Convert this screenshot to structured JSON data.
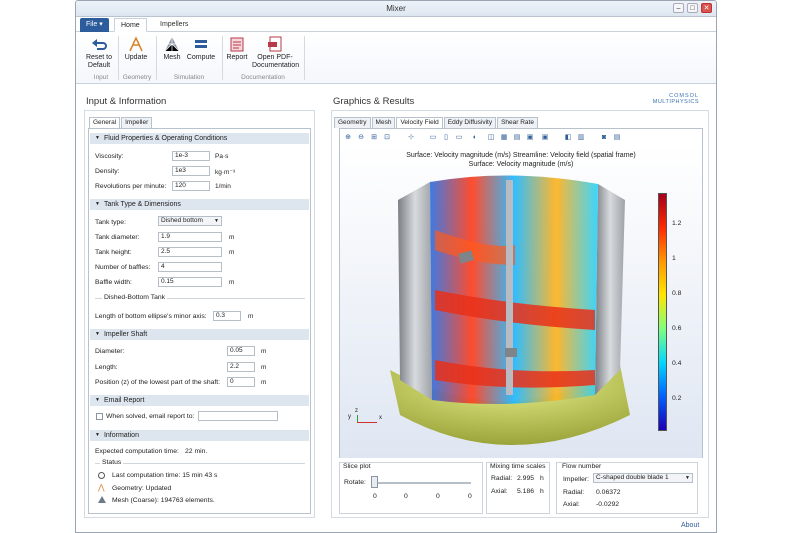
{
  "window": {
    "title": "Mixer"
  },
  "tabs": {
    "file": "File ▾",
    "home": "Home",
    "impellers": "Impellers"
  },
  "ribbon": {
    "reset": "Reset to\nDefault",
    "update": "Update",
    "mesh": "Mesh",
    "compute": "Compute",
    "report": "Report",
    "open_pdf": "Open PDF-\nDocumentation",
    "groups": {
      "input": "Input",
      "geometry": "Geometry",
      "simulation": "Simulation",
      "documentation": "Documentation"
    }
  },
  "left": {
    "title": "Input & Information",
    "tabs": [
      "General",
      "Impeller"
    ],
    "fluid": {
      "header": "Fluid Properties & Operating Conditions",
      "viscosity": {
        "label": "Viscosity:",
        "value": "1e-3",
        "unit": "Pa·s"
      },
      "density": {
        "label": "Density:",
        "value": "1e3",
        "unit": "kg·m⁻³"
      },
      "rpm": {
        "label": "Revolutions per minute:",
        "value": "120",
        "unit": "1/min"
      }
    },
    "tank": {
      "header": "Tank Type & Dimensions",
      "type": {
        "label": "Tank type:",
        "value": "Dished bottom"
      },
      "diameter": {
        "label": "Tank diameter:",
        "value": "1.9",
        "unit": "m"
      },
      "height": {
        "label": "Tank height:",
        "value": "2.5",
        "unit": "m"
      },
      "baffles": {
        "label": "Number of baffles:",
        "value": "4"
      },
      "baffle_width": {
        "label": "Baffle width:",
        "value": "0.15",
        "unit": "m"
      },
      "dished_header": "Dished-Bottom Tank",
      "ellipse": {
        "label": "Length of bottom ellipse's minor axis:",
        "value": "0.3",
        "unit": "m"
      }
    },
    "shaft": {
      "header": "Impeller Shaft",
      "diameter": {
        "label": "Diameter:",
        "value": "0.05",
        "unit": "m"
      },
      "length": {
        "label": "Length:",
        "value": "2.2",
        "unit": "m"
      },
      "position": {
        "label": "Position (z) of the lowest part of the shaft:",
        "value": "0",
        "unit": "m"
      }
    },
    "email": {
      "header": "Email Report",
      "label": "When solved, email report to:",
      "value": ""
    },
    "info": {
      "header": "Information",
      "expected": "Expected computation time:",
      "expected_value": "22 min.",
      "status": "Status",
      "last": "Last computation time: 15 min 43 s",
      "geometry": "Geometry: Updated",
      "mesh": "Mesh (Coarse): 194763 elements."
    }
  },
  "right": {
    "title": "Graphics & Results",
    "logo_top": "COMSOL",
    "logo_bottom": "MULTIPHYSICS",
    "tabs": [
      "Geometry",
      "Mesh",
      "Velocity Field",
      "Eddy Diffusivity",
      "Shear Rate"
    ],
    "plot_title_1": "Surface: Velocity magnitude (m/s)   Streamline: Velocity field (spatial frame)",
    "plot_title_2": "Surface: Velocity magnitude (m/s)",
    "colorbar_ticks": [
      "1.2",
      "1",
      "0.8",
      "0.6",
      "0.4",
      "0.2"
    ],
    "axes": {
      "x": "x",
      "y": "y",
      "z": "z"
    },
    "slice": {
      "header": "Slice plot",
      "rotate": "Rotate:",
      "ticks": [
        "0",
        "0",
        "0",
        "0"
      ]
    },
    "mixing": {
      "header": "Mixing time scales",
      "radial_label": "Radial:",
      "radial": "2.995",
      "axial_label": "Axial:",
      "axial": "5.186",
      "unit": "h"
    },
    "flow": {
      "header": "Flow number",
      "impeller_label": "Impeller:",
      "impeller": "C-shaped double blade 1",
      "radial_label": "Radial:",
      "radial": "0.06372",
      "axial_label": "Axial:",
      "axial": "-0.0292"
    }
  },
  "footer": {
    "about": "About"
  },
  "colors": {
    "accent": "#2c5c9c",
    "section": "#dde5ee"
  }
}
